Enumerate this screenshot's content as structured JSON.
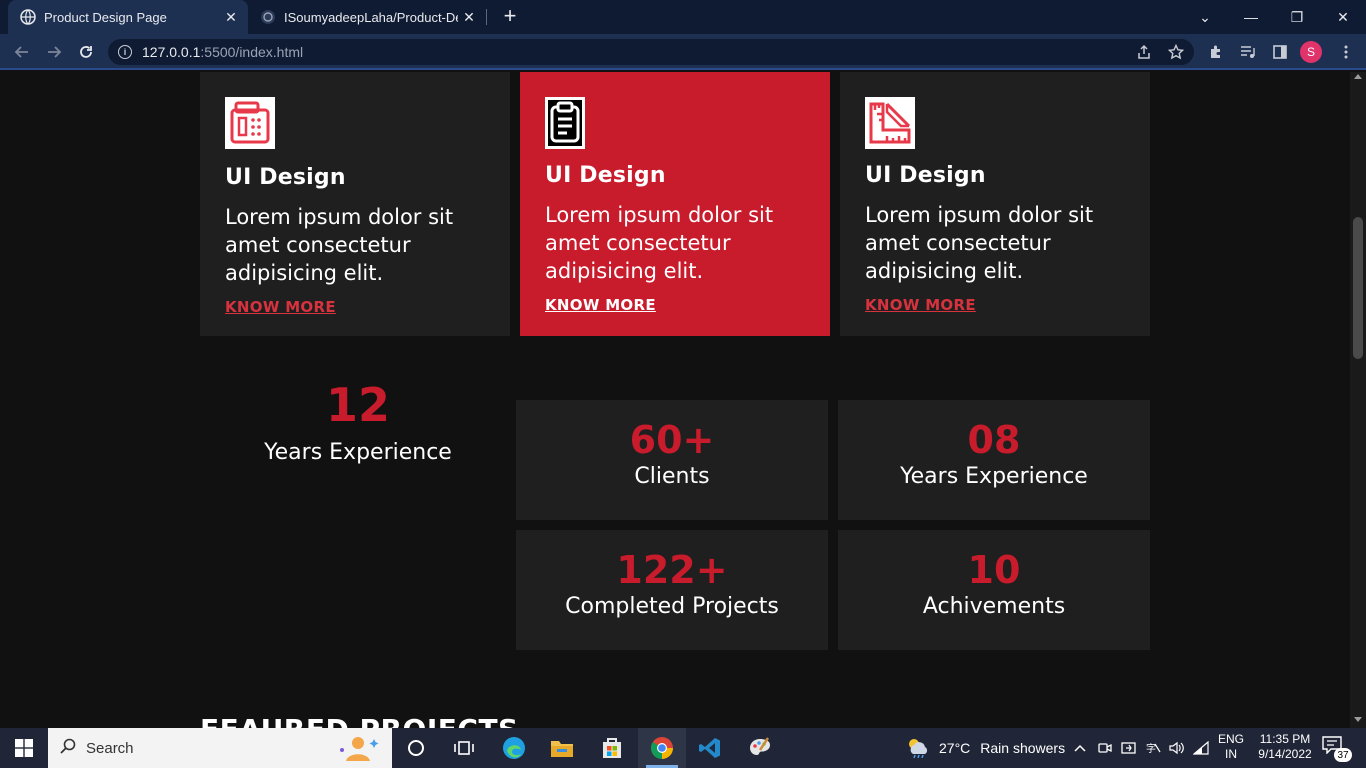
{
  "browser": {
    "tabs": [
      {
        "title": "Product Design Page",
        "active": true
      },
      {
        "title": "ISoumyadeepLaha/Product-Desig",
        "active": false
      }
    ],
    "address": {
      "host": "127.0.0.1",
      "path": ":5500/index.html"
    },
    "profile_initial": "S"
  },
  "services": {
    "cards": [
      {
        "title": "UI Design",
        "text": "Lorem ipsum dolor sit amet consectetur adipisicing elit.",
        "link": "KNOW MORE",
        "icon": "calculator-icon",
        "highlight": false
      },
      {
        "title": "UI Design",
        "text": "Lorem ipsum dolor sit amet consectetur adipisicing elit.",
        "link": "KNOW MORE",
        "icon": "clipboard-icon",
        "highlight": true
      },
      {
        "title": "UI Design",
        "text": "Lorem ipsum dolor sit amet consectetur adipisicing elit.",
        "link": "KNOW MORE",
        "icon": "ruler-icon",
        "highlight": false
      }
    ]
  },
  "stats": {
    "main": {
      "value": "12",
      "label": "Years Experience"
    },
    "boxes": [
      {
        "value": "60+",
        "label": "Clients"
      },
      {
        "value": "08",
        "label": "Years Experience"
      },
      {
        "value": "122+",
        "label": "Completed Projects"
      },
      {
        "value": "10",
        "label": "Achivements"
      }
    ]
  },
  "featured": {
    "heading": "FEAURED PROJECTS"
  },
  "colors": {
    "accent": "#c81b2b",
    "card_bg": "#1f1f1f",
    "page_bg": "#111111"
  },
  "taskbar": {
    "search_label": "Search",
    "weather": {
      "temp": "27°C",
      "condition": "Rain showers"
    },
    "language": {
      "line1": "ENG",
      "line2": "IN"
    },
    "clock": {
      "time": "11:35 PM",
      "date": "9/14/2022"
    },
    "notifications": "37"
  }
}
